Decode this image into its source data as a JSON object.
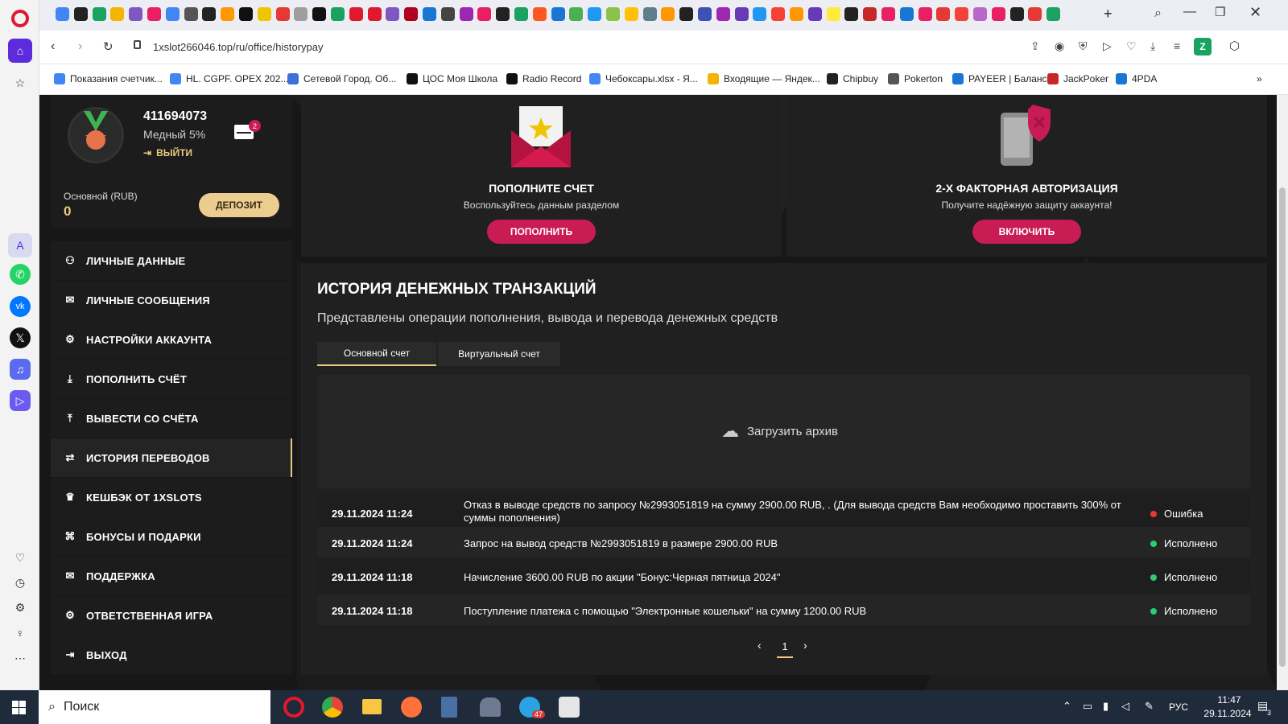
{
  "browser": {
    "url": "1xslot266046.top/ru/office/historypay",
    "ext_profile": "Z",
    "bookmarks": [
      "Показания счетчик...",
      "HL. CGPF. OPEX 202...",
      "Сетевой Город. Об...",
      "ЦОС Моя Школа",
      "Radio Record",
      "Чебоксары.xlsx - Я...",
      "Входящие — Яндек...",
      "Chipbuy",
      "Pokerton",
      "PAYEER | Баланс",
      "JackPoker",
      "4PDA"
    ]
  },
  "user": {
    "id": "411694073",
    "level": "Медный 5%",
    "logout": "ВЫЙТИ",
    "messages_count": "2"
  },
  "balance": {
    "label": "Основной (RUB)",
    "value": "0",
    "deposit_button": "ДЕПОЗИТ"
  },
  "menu": [
    {
      "label": "ЛИЧНЫЕ ДАННЫЕ",
      "icon": "user-plus-icon"
    },
    {
      "label": "ЛИЧНЫЕ СООБЩЕНИЯ",
      "icon": "envelope-icon"
    },
    {
      "label": "НАСТРОЙКИ АККАУНТА",
      "icon": "gears-icon"
    },
    {
      "label": "ПОПОЛНИТЬ СЧЁТ",
      "icon": "download-icon"
    },
    {
      "label": "ВЫВЕСТИ СО СЧЁТА",
      "icon": "upload-icon"
    },
    {
      "label": "ИСТОРИЯ ПЕРЕВОДОВ",
      "icon": "transfer-icon"
    },
    {
      "label": "КЕШБЭК ОТ 1XSLOTS",
      "icon": "crown-icon"
    },
    {
      "label": "БОНУСЫ И ПОДАРКИ",
      "icon": "gift-icon"
    },
    {
      "label": "ПОДДЕРЖКА",
      "icon": "envelope-icon"
    },
    {
      "label": "ОТВЕТСТВЕННАЯ ИГРА",
      "icon": "gears-icon"
    },
    {
      "label": "ВЫХОД",
      "icon": "exit-icon"
    }
  ],
  "promo": [
    {
      "title": "ПОПОЛНИТЕ СЧЕТ",
      "subtitle": "Воспользуйтесь данным разделом",
      "button": "ПОПОЛНИТЬ"
    },
    {
      "title": "2-Х ФАКТОРНАЯ АВТОРИЗАЦИЯ",
      "subtitle": "Получите надёжную защиту аккаунта!",
      "button": "ВКЛЮЧИТЬ"
    }
  ],
  "history": {
    "title": "ИСТОРИЯ ДЕНЕЖНЫХ ТРАНЗАКЦИЙ",
    "subtitle": "Представлены операции пополнения, вывода и перевода денежных средств",
    "tabs": [
      "Основной счет",
      "Виртуальный счет"
    ],
    "archive": "Загрузить архив",
    "rows": [
      {
        "date": "29.11.2024 11:24",
        "text": "Отказ в выводе средств по запросу №2993051819 на сумму 2900.00 RUB, . (Для вывода средств Вам необходимо проставить 300% от суммы пополнения)",
        "status": "Ошибка",
        "color": "#e53935"
      },
      {
        "date": "29.11.2024 11:24",
        "text": "Запрос на вывод средств №2993051819 в размере 2900.00 RUB",
        "status": "Исполнено",
        "color": "#2ecc71"
      },
      {
        "date": "29.11.2024 11:18",
        "text": "Начисление 3600.00 RUB по акции \"Бонус:Черная пятница 2024\"",
        "status": "Исполнено",
        "color": "#2ecc71"
      },
      {
        "date": "29.11.2024 11:18",
        "text": "Поступление платежа с помощью \"Электронные кошельки\" на сумму 1200.00 RUB",
        "status": "Исполнено",
        "color": "#2ecc71"
      }
    ],
    "page": "1"
  },
  "taskbar": {
    "search": "Поиск",
    "lang": "РУС",
    "time": "11:47",
    "date": "29.11.2024",
    "telegram_badge": "47",
    "notif": "3"
  },
  "colors": {
    "accent_gold": "#e9c97d",
    "pink": "#c91b54"
  }
}
